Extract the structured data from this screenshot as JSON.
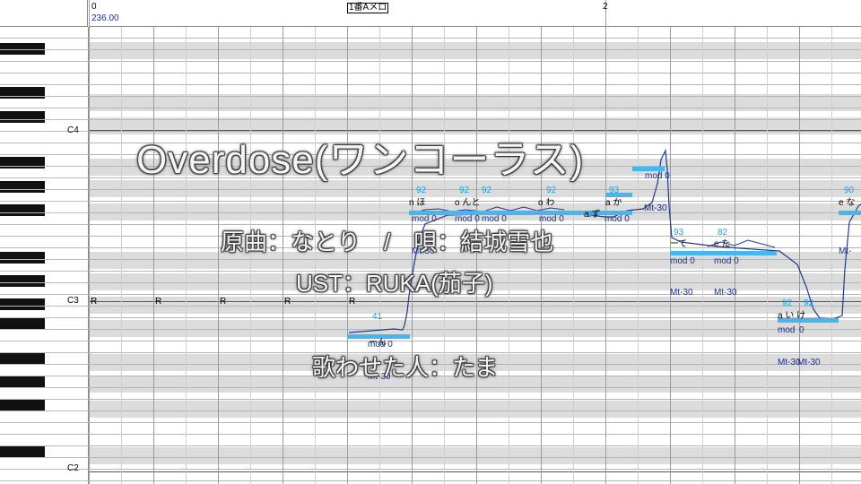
{
  "ruler": {
    "measure_start": "0",
    "tempo": "236.00",
    "section_label": "1番Aメロ",
    "measure_next": "2"
  },
  "keyboard": {
    "labels": [
      "C4",
      "C3",
      "C2"
    ]
  },
  "rests": [
    "R",
    "R",
    "R",
    "R",
    "R"
  ],
  "notes": [
    {
      "lyric": "ーん",
      "velocity": "41",
      "mod": "mod 0",
      "mt": "Mt-30"
    },
    {
      "lyric": "n ほ",
      "velocity": "92",
      "mod": "mod 0",
      "mt": "Mt-30"
    },
    {
      "lyric": "o んと",
      "velocity": "92",
      "mod": "mod 0",
      "mt": ""
    },
    {
      "lyric": "",
      "velocity": "92",
      "mod": "mod 0",
      "mt": ""
    },
    {
      "lyric": "o わ",
      "velocity": "92",
      "mod": "mod 0",
      "mt": ""
    },
    {
      "lyric": "",
      "velocity": "92",
      "mod": "mod 0",
      "mt": "Mt-30"
    },
    {
      "lyric": "a ず",
      "velocity": "93",
      "mod": "mod 0",
      "mt": ""
    },
    {
      "lyric": "a か",
      "velocity": "",
      "mod": "",
      "mt": ""
    },
    {
      "lyric": "",
      "velocity": "93",
      "mod": "mod 0",
      "mt": "Mt-30"
    },
    {
      "lyric": "ーて",
      "velocity": "93",
      "mod": "mod 0",
      "mt": "Mt-30"
    },
    {
      "lyric": "e た",
      "velocity": "82",
      "mod": "mod 0",
      "mt": "Mt-30"
    },
    {
      "lyric": "a い け",
      "velocity": "92",
      "mod": "mod",
      "mt": "Mt-30"
    },
    {
      "lyric": "",
      "velocity": "92",
      "mod": "0",
      "mt": "Mt-30"
    },
    {
      "lyric": "e な",
      "velocity": "90",
      "mod": "",
      "mt": "Mt-"
    }
  ],
  "overlay": {
    "title": "Overdose(ワンコーラス)",
    "credit_line1": "原曲：なとり　/　唄：結城雪也",
    "credit_line2": "UST：RUKA(茄子)",
    "credit_line3": "歌わせた人：たま"
  },
  "colors": {
    "measure_line": "#ff5cff",
    "beat_line": "#8f8ff0",
    "note": "#44b6f2",
    "velocity_text": "#1aa0ea",
    "param_text": "#1d2f86",
    "pitch_curve": "#1f3a8f"
  }
}
